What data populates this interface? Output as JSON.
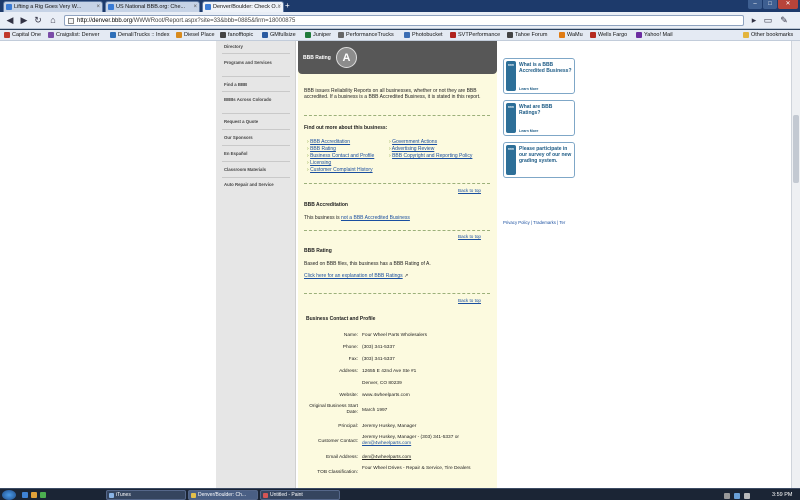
{
  "browser": {
    "tabs": [
      {
        "label": "Lifting a Rig Goes Very W...",
        "active": false
      },
      {
        "label": "US National BBB.org: Che...",
        "active": false
      },
      {
        "label": "Denver/Boulder: Check O...",
        "active": true
      }
    ],
    "url_host": "http://denver.bbb.org",
    "url_path": "/WWWRoot/Report.aspx?site=33&bbb=0885&firm=18000875",
    "bookmarks": [
      "Capital One",
      "Craigslist: Denver",
      "DenaliTrucks :: Index",
      "Diesel Place",
      "fanofftopic",
      "GMfullsize",
      "Juniper",
      "PerformanceTrucks",
      "Photobucket",
      "SVTPerformance",
      "Tahoe Forum",
      "WaMu",
      "Wells Fargo",
      "Yahoo! Mail"
    ],
    "other_bookmarks": "Other bookmarks"
  },
  "leftnav": [
    "Directory",
    "Programs and Services",
    "Find a BBB",
    "BBBs Across Colorado",
    "Request a Quote",
    "Our Sponsors",
    "En Español",
    "Classroom Materials",
    "Auto Repair and Service"
  ],
  "rating_header": {
    "label": "BBB Rating",
    "grade": "A"
  },
  "intro": "BBB issues Reliability Reports on all businesses, whether or not they are BBB accredited. If a business is a BBB Accredited Business, it is stated in this report.",
  "find_out": {
    "heading": "Find out more about this business:",
    "left_links": [
      "BBB Accreditation",
      "BBB Rating",
      "Business Contact and Profile",
      "Licensing",
      "Customer Complaint History"
    ],
    "right_links": [
      "Government Actions",
      "Advertising Review",
      "BBB Copyright and Reporting Policy"
    ]
  },
  "back_to_top": "Back to top",
  "accreditation": {
    "heading": "BBB Accreditation",
    "text_prefix": "This business is ",
    "link": "not a BBB Accredited Business"
  },
  "rating": {
    "heading": "BBB Rating",
    "text": "Based on BBB files, this business has a BBB Rating of A.",
    "link": "Click here for an explanation of BBB Ratings"
  },
  "profile": {
    "heading": "Business Contact and Profile",
    "name_label": "Name:",
    "name": "Four Wheel Parts Wholesalers",
    "phone_label": "Phone:",
    "phone": "(303) 341-5337",
    "fax_label": "Fax:",
    "fax": "(303) 341-5337",
    "address_label": "Address:",
    "address1": "12655 E 42nd Ave Ste #1",
    "address2": "Denver, CO 80239",
    "website_label": "Website:",
    "website": "www.4wheelparts.com",
    "start_label": "Original Business Start Date:",
    "start": "March 1997",
    "principal_label": "Principal:",
    "principal": "Jeremy Huskey, Manager",
    "contact_label": "Customer Contact:",
    "contact": "Jeremy Huskey, Manager - (303) 341-5337 or",
    "contact_email": "den@4wheelparts.com",
    "email_label": "Email Address:",
    "email": "den@4wheelparts.com",
    "tob_label": "TOB Classification:",
    "tob": "Four Wheel Drives - Repair & Service, Tire Dealers"
  },
  "promos": [
    {
      "title": "What is a BBB Accredited Business?",
      "more": "Learn More"
    },
    {
      "title": "What are BBB Ratings?",
      "more": "Learn More"
    },
    {
      "title": "Please participate in our survey of our new grading system.",
      "more": ""
    }
  ],
  "footer_links": "Privacy Policy | Trademarks | Ter",
  "taskbar": {
    "tasks": [
      {
        "label": "iTunes",
        "active": false
      },
      {
        "label": "Denver/Boulder: Ch...",
        "active": true
      },
      {
        "label": "Untitled - Paint",
        "active": false
      }
    ],
    "clock": "3:59 PM"
  }
}
